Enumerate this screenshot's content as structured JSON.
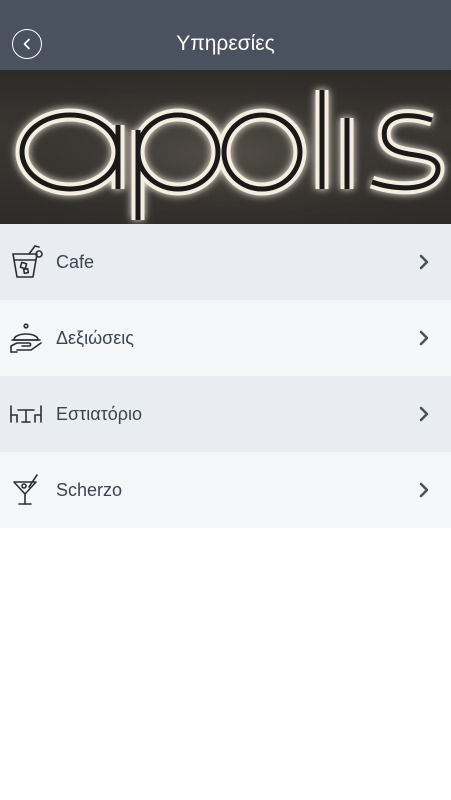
{
  "header": {
    "title": "Υπηρεσίες",
    "bg_color": "#4a5260"
  },
  "banner": {
    "logo_text": "apolis"
  },
  "services": [
    {
      "label": "Cafe",
      "icon": "iced-drink-icon"
    },
    {
      "label": "Δεξιώσεις",
      "icon": "serving-cloche-icon"
    },
    {
      "label": "Εστιατόριο",
      "icon": "dining-table-icon"
    },
    {
      "label": "Scherzo",
      "icon": "cocktail-glass-icon"
    }
  ]
}
